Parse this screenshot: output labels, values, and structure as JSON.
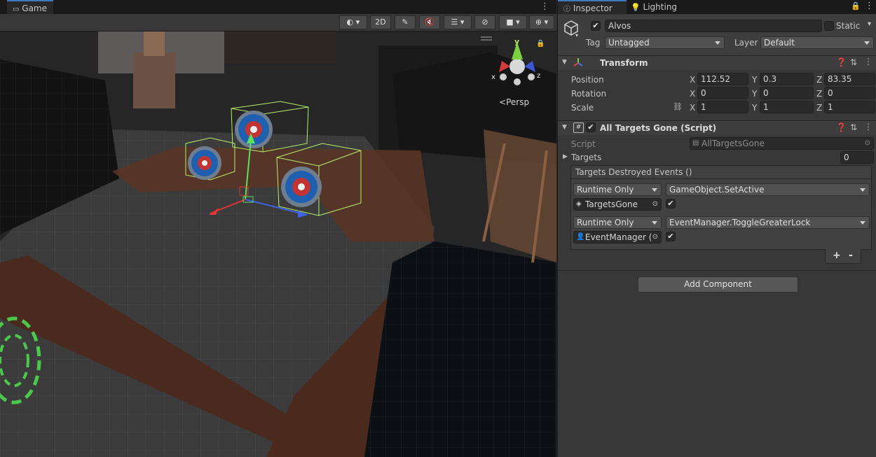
{
  "left_panel": {
    "tab_label": "Game",
    "toolbar": {
      "two_d_label": "2D"
    },
    "gizmo": {
      "persp_label": "Persp",
      "axis_y": "y",
      "axis_x": "x",
      "axis_z": "z"
    }
  },
  "inspector": {
    "tabs": {
      "inspector": "Inspector",
      "lighting": "Lighting"
    },
    "object": {
      "name": "Alvos",
      "static_label": "Static",
      "tag_label": "Tag",
      "tag_value": "Untagged",
      "layer_label": "Layer",
      "layer_value": "Default"
    },
    "transform": {
      "title": "Transform",
      "position_label": "Position",
      "rotation_label": "Rotation",
      "scale_label": "Scale",
      "axis_x": "X",
      "axis_y": "Y",
      "axis_z": "Z",
      "position": {
        "x": "112.52",
        "y": "0.3",
        "z": "83.35"
      },
      "rotation": {
        "x": "0",
        "y": "0",
        "z": "0"
      },
      "scale": {
        "x": "1",
        "y": "1",
        "z": "1"
      }
    },
    "script_component": {
      "title": "All Targets Gone (Script)",
      "script_label": "Script",
      "script_value": "AllTargetsGone",
      "targets_label": "Targets",
      "targets_count": "0",
      "event_title": "Targets Destroyed Events ()",
      "events": [
        {
          "runtime": "Runtime Only",
          "function": "GameObject.SetActive",
          "object": "TargetsGone",
          "checked": true
        },
        {
          "runtime": "Runtime Only",
          "function": "EventManager.ToggleGreaterLock",
          "object": "EventManager (",
          "checked": true
        }
      ],
      "plus": "+",
      "minus": "-"
    },
    "add_component_label": "Add Component"
  },
  "colors": {
    "accent_blue": "#3a79bb",
    "selection_green": "#b8f06a",
    "panel_bg": "#383838"
  }
}
